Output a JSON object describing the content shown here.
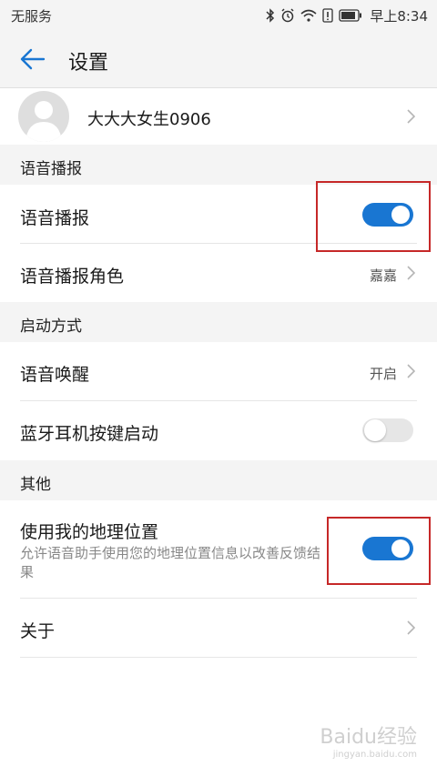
{
  "status": {
    "carrier": "无服务",
    "time": "早上8:34"
  },
  "header": {
    "title": "设置"
  },
  "profile": {
    "name": "大大大女生0906"
  },
  "sections": {
    "voice": {
      "title": "语音播报"
    },
    "launch": {
      "title": "启动方式"
    },
    "other": {
      "title": "其他"
    }
  },
  "rows": {
    "voice_broadcast": {
      "label": "语音播报",
      "enabled": true
    },
    "voice_role": {
      "label": "语音播报角色",
      "value": "嘉嘉"
    },
    "voice_wakeup": {
      "label": "语音唤醒",
      "value": "开启"
    },
    "bt_launch": {
      "label": "蓝牙耳机按键启动",
      "enabled": false
    },
    "location": {
      "label": "使用我的地理位置",
      "description": "允许语音助手使用您的地理位置信息以改善反馈结果",
      "enabled": true
    },
    "about": {
      "label": "关于"
    }
  },
  "watermark": {
    "brand": "Baidu经验",
    "url": "jingyan.baidu.com"
  },
  "colors": {
    "accent": "#1976d2",
    "highlight_box": "#c62828"
  }
}
